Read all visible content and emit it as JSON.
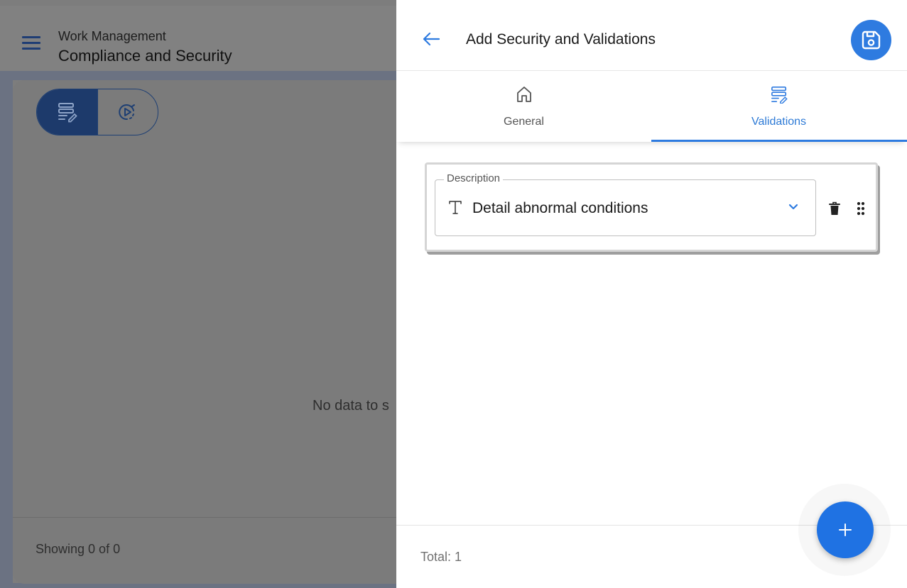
{
  "background": {
    "header": {
      "subtitle": "Work Management",
      "title": "Compliance and Security",
      "menu_icon": "hamburger-menu-icon"
    },
    "view_toggle": {
      "left_icon": "list-edit-icon",
      "right_icon": "play-circle-icon"
    },
    "empty_message": "No data to s",
    "footer": {
      "showing": "Showing 0 of 0"
    }
  },
  "panel": {
    "header": {
      "back_icon": "arrow-left-icon",
      "title": "Add Security and Validations",
      "save_icon": "floppy-disk-icon"
    },
    "tabs": [
      {
        "label": "General",
        "icon": "home-icon",
        "active": false
      },
      {
        "label": "Validations",
        "icon": "list-edit-icon",
        "active": true
      }
    ],
    "validations": [
      {
        "field_label": "Description",
        "type_icon": "text-type-icon",
        "value": "Detail abnormal conditions",
        "dropdown_icon": "chevron-down-icon",
        "delete_icon": "trash-icon",
        "drag_icon": "drag-handle-icon"
      }
    ],
    "footer": {
      "total": "Total: 1"
    },
    "fab": {
      "icon": "plus-icon"
    }
  },
  "colors": {
    "accent": "#2e7be0",
    "overlay": "#7d7d7d",
    "dark_blue": "#1d3a6b"
  }
}
